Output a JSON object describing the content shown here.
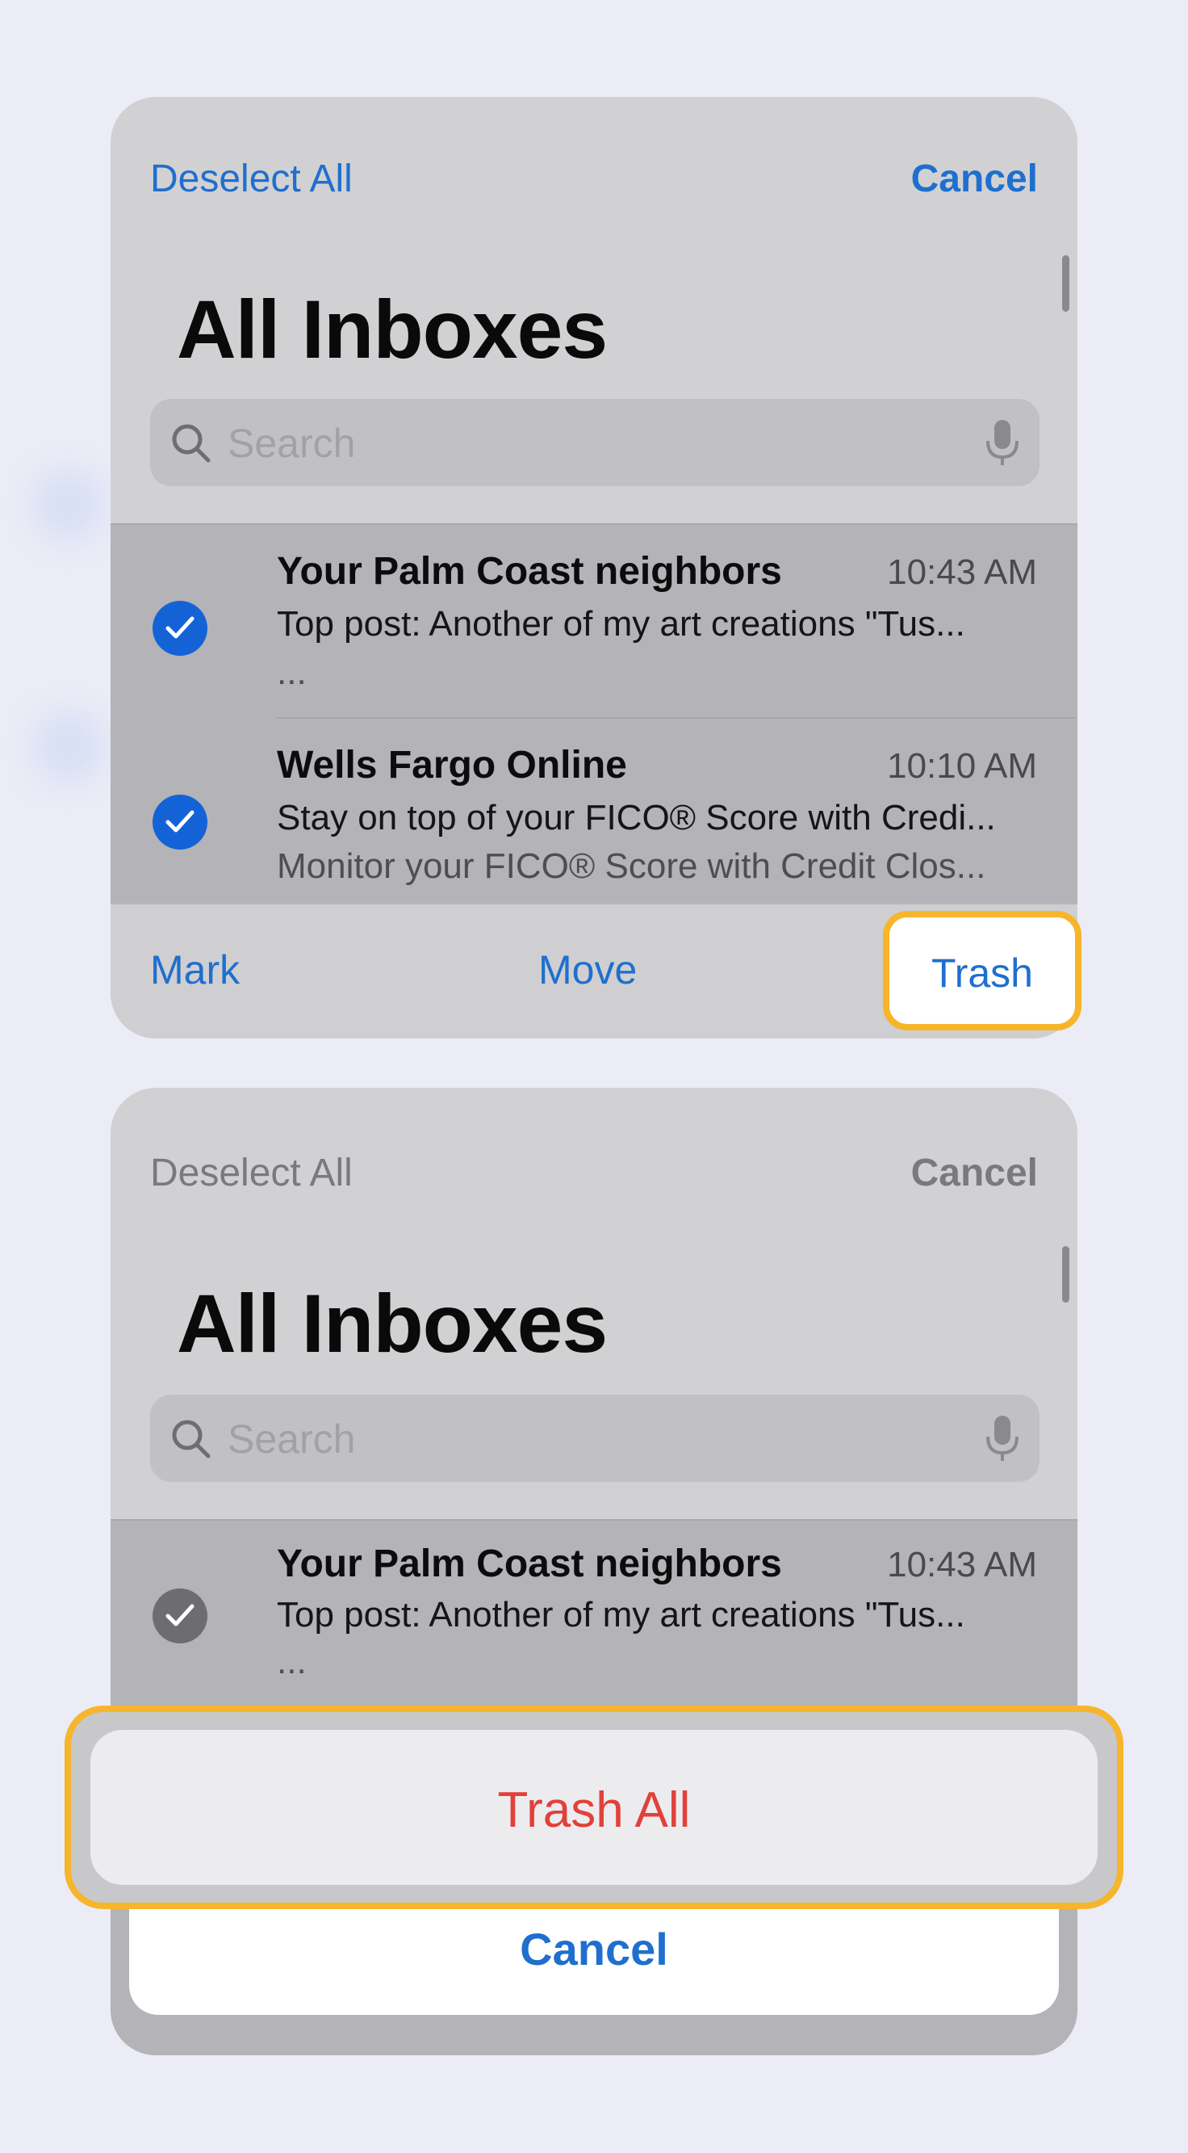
{
  "panel_top": {
    "nav": {
      "left_label": "Deselect All",
      "right_label": "Cancel"
    },
    "title": "All Inboxes",
    "search": {
      "placeholder": "Search"
    },
    "messages": [
      {
        "sender": "Your Palm Coast neighbors",
        "time": "10:43 AM",
        "preview_line1": "Top post: Another of my art creations \"Tus...",
        "preview_line2": "...",
        "selected": true
      },
      {
        "sender": "Wells Fargo Online",
        "time": "10:10 AM",
        "preview_line1": "Stay on top of your FICO® Score with Credi...",
        "preview_line2": "Monitor your FICO® Score with Credit Clos...",
        "selected": true
      }
    ],
    "toolbar": {
      "mark": "Mark",
      "move": "Move",
      "trash": "Trash"
    }
  },
  "panel_bottom": {
    "nav": {
      "left_label": "Deselect All",
      "right_label": "Cancel"
    },
    "title": "All Inboxes",
    "search": {
      "placeholder": "Search"
    },
    "messages": [
      {
        "sender": "Your Palm Coast neighbors",
        "time": "10:43 AM",
        "preview_line1": "Top post: Another of my art creations \"Tus...",
        "preview_line2": "...",
        "selected": true
      }
    ],
    "action_sheet": {
      "trash_all": "Trash All",
      "cancel": "Cancel"
    }
  },
  "colors": {
    "accent": "#1f6fce",
    "destructive": "#e2403a",
    "highlight": "#f6b52a",
    "check_selected": "#1463d6"
  }
}
